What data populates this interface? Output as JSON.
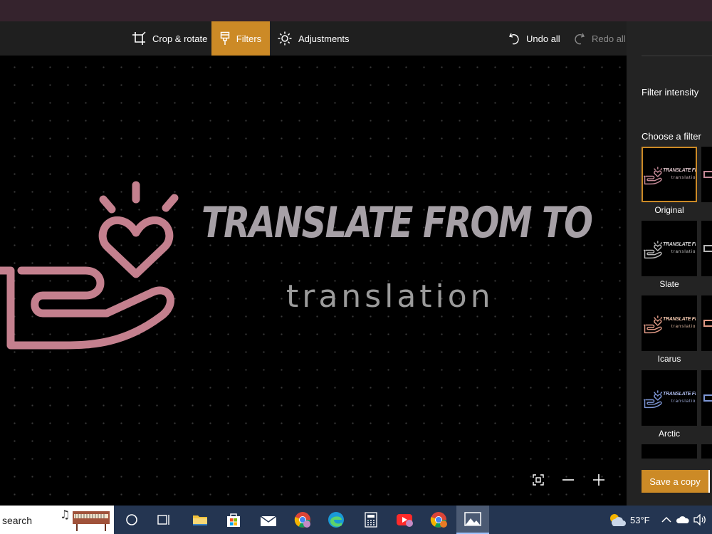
{
  "toolbar": {
    "crop_label": "Crop & rotate",
    "filters_label": "Filters",
    "adjustments_label": "Adjustments",
    "undo_label": "Undo all",
    "redo_label": "Redo all"
  },
  "image": {
    "title": "TRANSLATE FROM TO",
    "subtitle": "translation"
  },
  "panel": {
    "intensity_label": "Filter intensity",
    "choose_label": "Choose a filter",
    "filters": [
      {
        "name": "Original",
        "selected": true,
        "icon_color": "#c58a97",
        "text_color": "#d9c0c6"
      },
      {
        "name": "Slate",
        "selected": false,
        "icon_color": "#b8b8b8",
        "text_color": "#d0d0d0"
      },
      {
        "name": "Icarus",
        "selected": false,
        "icon_color": "#e09a86",
        "text_color": "#f0c6ad"
      },
      {
        "name": "Arctic",
        "selected": false,
        "icon_color": "#7d96d6",
        "text_color": "#a7b5e5"
      }
    ],
    "save_label": "Save a copy"
  },
  "taskbar": {
    "search_text": "search",
    "temperature": "53°F"
  },
  "colors": {
    "accent": "#cc8a26",
    "logo_pink": "#c4808e",
    "title_gray": "#a6a0a6"
  }
}
